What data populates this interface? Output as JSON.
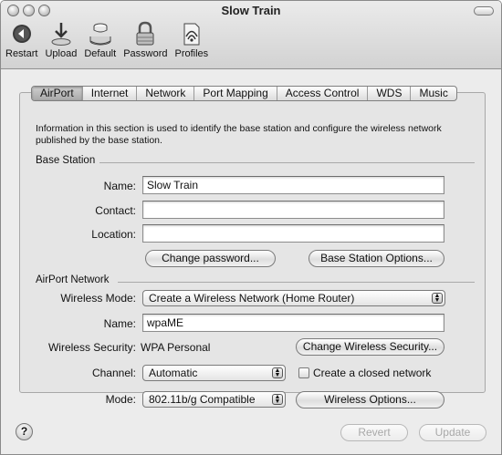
{
  "window": {
    "title": "Slow Train"
  },
  "toolbar": {
    "items": [
      {
        "label": "Restart",
        "icon": "restart-icon"
      },
      {
        "label": "Upload",
        "icon": "upload-icon"
      },
      {
        "label": "Default",
        "icon": "default-icon"
      },
      {
        "label": "Password",
        "icon": "lock-icon"
      },
      {
        "label": "Profiles",
        "icon": "profiles-icon"
      }
    ]
  },
  "tabs": [
    {
      "label": "AirPort",
      "selected": true
    },
    {
      "label": "Internet",
      "selected": false
    },
    {
      "label": "Network",
      "selected": false
    },
    {
      "label": "Port Mapping",
      "selected": false
    },
    {
      "label": "Access Control",
      "selected": false
    },
    {
      "label": "WDS",
      "selected": false
    },
    {
      "label": "Music",
      "selected": false
    }
  ],
  "info_text": "Information in this section is used to identify the base station and configure the wireless network published by the base station.",
  "base_station": {
    "heading": "Base Station",
    "name_label": "Name:",
    "name_value": "Slow Train",
    "contact_label": "Contact:",
    "contact_value": "",
    "location_label": "Location:",
    "location_value": "",
    "change_password_button": "Change password...",
    "options_button": "Base Station Options..."
  },
  "airport_network": {
    "heading": "AirPort Network",
    "wireless_mode_label": "Wireless Mode:",
    "wireless_mode_value": "Create a Wireless Network (Home Router)",
    "name_label": "Name:",
    "name_value": "wpaME",
    "security_label": "Wireless Security:",
    "security_value": "WPA Personal",
    "change_security_button": "Change Wireless Security...",
    "channel_label": "Channel:",
    "channel_value": "Automatic",
    "closed_network_label": "Create a closed network",
    "closed_network_checked": false,
    "mode_label": "Mode:",
    "mode_value": "802.11b/g Compatible",
    "wireless_options_button": "Wireless Options..."
  },
  "footer": {
    "help_glyph": "?",
    "revert_button": "Revert",
    "update_button": "Update"
  }
}
